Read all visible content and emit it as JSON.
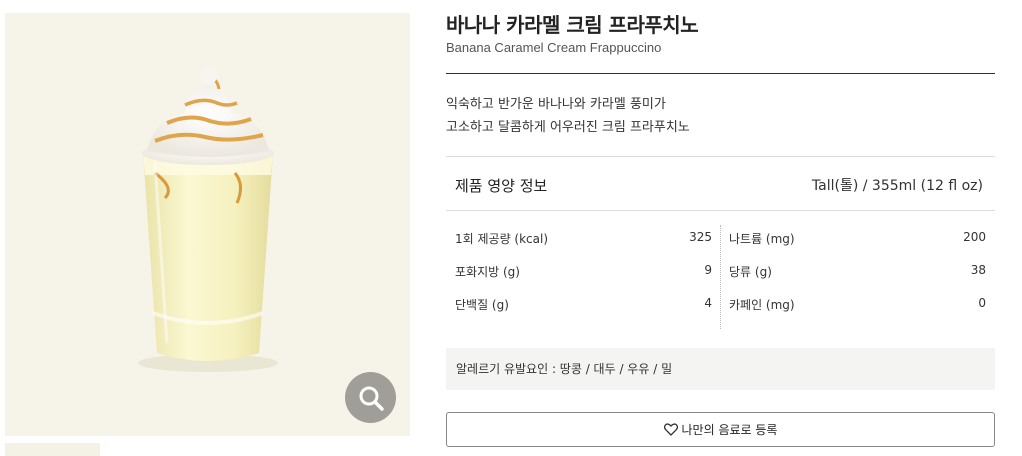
{
  "product": {
    "name_ko": "바나나 카라멜 크림 프라푸치노",
    "name_en": "Banana Caramel Cream Frappuccino",
    "description_line1": "익숙하고 반가운 바나나와 카라멜 풍미가",
    "description_line2": "고소하고 달콤하게 어우러진 크림 프라푸치노"
  },
  "nutrition": {
    "heading": "제품 영양 정보",
    "serving": "Tall(톨) / 355ml (12 fl oz)",
    "left": [
      {
        "label": "1회 제공량 (kcal)",
        "value": "325"
      },
      {
        "label": "포화지방 (g)",
        "value": "9"
      },
      {
        "label": "단백질 (g)",
        "value": "4"
      }
    ],
    "right": [
      {
        "label": "나트륨 (mg)",
        "value": "200"
      },
      {
        "label": "당류 (g)",
        "value": "38"
      },
      {
        "label": "카페인 (mg)",
        "value": "0"
      }
    ]
  },
  "allergy": {
    "text": "알레르기 유발요인 : 땅콩 / 대두 / 우유 / 밀"
  },
  "actions": {
    "favorite_label": "나만의 음료로 등록"
  },
  "icons": {
    "zoom": "magnifier-icon",
    "favorite": "heart-outline-icon"
  },
  "colors": {
    "image_bg": "#f6f3e8",
    "zoom_btn": "#a09e98",
    "allergy_bg": "#f4f4f2"
  }
}
